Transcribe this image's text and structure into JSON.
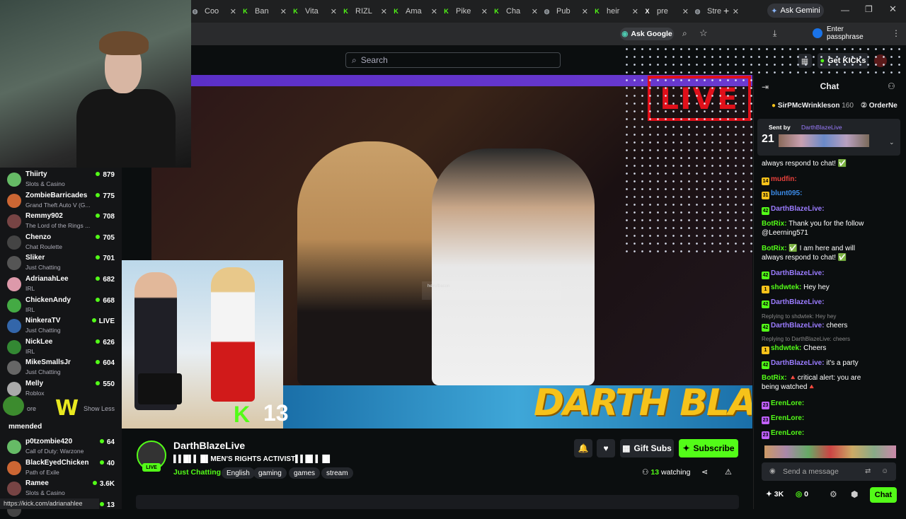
{
  "browser": {
    "tabs": [
      {
        "label": "Coo",
        "icon": "globe-icon"
      },
      {
        "label": "Ban",
        "icon": "kick-icon"
      },
      {
        "label": "Vita",
        "icon": "kick-icon"
      },
      {
        "label": "RIZL",
        "icon": "kick-icon"
      },
      {
        "label": "Ama",
        "icon": "kick-icon"
      },
      {
        "label": "Pike",
        "icon": "kick-icon"
      },
      {
        "label": "Cha",
        "icon": "kick-icon"
      },
      {
        "label": "Pub",
        "icon": "globe-icon"
      },
      {
        "label": "heir",
        "icon": "kick-icon"
      },
      {
        "label": "pre",
        "icon": "x-icon"
      },
      {
        "label": "Stre",
        "icon": "globe-icon"
      }
    ],
    "new_tab": "+",
    "ask_gemini": "Ask Gemini",
    "ask_google": "Ask Google",
    "enter_passphrase": "Enter passphrase",
    "status_url": "https://kick.com/adrianahlee"
  },
  "kick": {
    "search_placeholder": "Search",
    "get_kicks": "Get KICKs"
  },
  "sidebar": {
    "items": [
      {
        "name": "Thiirty",
        "category": "Slots & Casino",
        "viewers": "879"
      },
      {
        "name": "ZombieBarricades",
        "category": "Grand Theft Auto V (G...",
        "viewers": "775"
      },
      {
        "name": "Remmy902",
        "category": "The Lord of the Rings ...",
        "viewers": "708"
      },
      {
        "name": "Chenzo",
        "category": "Chat Roulette",
        "viewers": "705"
      },
      {
        "name": "Sliker",
        "category": "Just Chatting",
        "viewers": "701"
      },
      {
        "name": "AdrianahLee",
        "category": "IRL",
        "viewers": "682"
      },
      {
        "name": "ChickenAndy",
        "category": "IRL",
        "viewers": "668"
      },
      {
        "name": "NinkeraTV",
        "category": "Just Chatting",
        "viewers": "LIVE"
      },
      {
        "name": "NickLee",
        "category": "IRL",
        "viewers": "626"
      },
      {
        "name": "MikeSmallsJr",
        "category": "Just Chatting",
        "viewers": "604"
      },
      {
        "name": "Melly",
        "category": "Roblox",
        "viewers": "550"
      }
    ],
    "show_more": "ore",
    "show_less": "Show Less",
    "recommended": "mmended",
    "recommended_items": [
      {
        "name": "p0tzombie420",
        "category": "Call of Duty: Warzone",
        "viewers": "64"
      },
      {
        "name": "BlackEyedChicken",
        "category": "Path of Exile",
        "viewers": "40"
      },
      {
        "name": "Ramee",
        "category": "Slots & Casino",
        "viewers": "3.6K"
      },
      {
        "name": "",
        "category": "",
        "viewers": "13"
      }
    ]
  },
  "video": {
    "live_overlay": "LIVE",
    "banner_text": "DARTH BLAZE",
    "pip_counter": "13",
    "pip_k": "K",
    "watermark": "heirofbacon"
  },
  "stream": {
    "channel_name": "DarthBlazeLive",
    "live_badge": "LIVE",
    "title": "▌▌█▌▌ █▌MEN'S RIGHTS ACTIVIST▌▌█▌▌ █▌",
    "category": "Just Chatting",
    "tags": [
      "English",
      "gaming",
      "games",
      "stream"
    ],
    "gift_subs": "Gift Subs",
    "subscribe": "Subscribe",
    "watching_count": "13",
    "watching_label": "watching"
  },
  "chat": {
    "header": "Chat",
    "pinned": [
      {
        "user": "SirPMcWrinkleson",
        "amount": "160"
      },
      {
        "user": "OrderNe",
        "amount": ""
      }
    ],
    "sent_by_label": "Sent by",
    "sent_by_user": "DarthBlazeLive",
    "sent_count": "21",
    "messages": [
      {
        "badge": "",
        "user": "",
        "text": "always respond to chat! ✅",
        "color": "#ffffff"
      },
      {
        "badge": "14",
        "user": "mudfin:",
        "text": "",
        "color": "#e8403b"
      },
      {
        "badge": "31",
        "user": "blunt095:",
        "text": "",
        "color": "#3b8be8"
      },
      {
        "badge": "42",
        "user": "DarthBlazeLive:",
        "text": "",
        "color": "#9b7cff"
      },
      {
        "badge": "",
        "user": "BotRix:",
        "text": "Thank you for the follow",
        "color": "#53fc18"
      },
      {
        "badge": "",
        "user": "",
        "text": "@Leerning571",
        "color": "#ffffff"
      },
      {
        "badge": "",
        "user": "BotRix:",
        "text": "✅ I am here and will",
        "color": "#53fc18"
      },
      {
        "badge": "",
        "user": "",
        "text": "always respond to chat! ✅",
        "color": "#ffffff"
      },
      {
        "badge": "42",
        "user": "DarthBlazeLive:",
        "text": "",
        "color": "#9b7cff"
      },
      {
        "badge": "1",
        "user": "shdwtek:",
        "text": "Hey hey",
        "color": "#53fc18"
      },
      {
        "badge": "42",
        "user": "DarthBlazeLive:",
        "text": "",
        "color": "#9b7cff"
      },
      {
        "badge": "42",
        "user": "DarthBlazeLive:",
        "text": "cheers",
        "color": "#9b7cff"
      },
      {
        "badge": "1",
        "user": "shdwtek:",
        "text": "Cheers",
        "color": "#53fc18"
      },
      {
        "badge": "42",
        "user": "DarthBlazeLive:",
        "text": "it's a party",
        "color": "#9b7cff"
      },
      {
        "badge": "",
        "user": "BotRix:",
        "text": "🔺critical alert: you are",
        "color": "#53fc18"
      },
      {
        "badge": "",
        "user": "",
        "text": "being watched🔺",
        "color": "#ffffff"
      },
      {
        "badge": "23",
        "user": "ErenLore:",
        "text": "",
        "color": "#53fc18"
      },
      {
        "badge": "23",
        "user": "ErenLore:",
        "text": "",
        "color": "#53fc18"
      },
      {
        "badge": "23",
        "user": "ErenLore:",
        "text": "",
        "color": "#53fc18"
      }
    ],
    "replies": [
      "Replying to shdwtek: Hey hey",
      "Replying to DarthBlazeLive: cheers"
    ],
    "input_placeholder": "Send a message",
    "kicks_count": "3K",
    "points": "0",
    "chat_button": "Chat"
  },
  "colors": {
    "accent": "#53fc18",
    "live_red": "#e0101a",
    "banner_yellow": "#f6c21a"
  }
}
